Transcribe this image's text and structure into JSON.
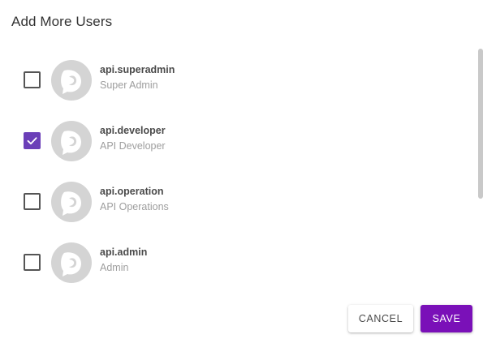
{
  "dialog": {
    "title": "Add More Users",
    "cancel_label": "CANCEL",
    "save_label": "SAVE"
  },
  "users": [
    {
      "username": "api.superadmin",
      "role": "Super Admin",
      "checked": false
    },
    {
      "username": "api.developer",
      "role": "API Developer",
      "checked": true
    },
    {
      "username": "api.operation",
      "role": "API Operations",
      "checked": false
    },
    {
      "username": "api.admin",
      "role": "Admin",
      "checked": false
    }
  ],
  "colors": {
    "accent": "#7a10b8",
    "checkbox_checked": "#6b3fb8",
    "avatar_bg": "#d4d4d4"
  },
  "icons": {
    "avatar": "default-user-avatar-icon",
    "check": "check-icon"
  }
}
